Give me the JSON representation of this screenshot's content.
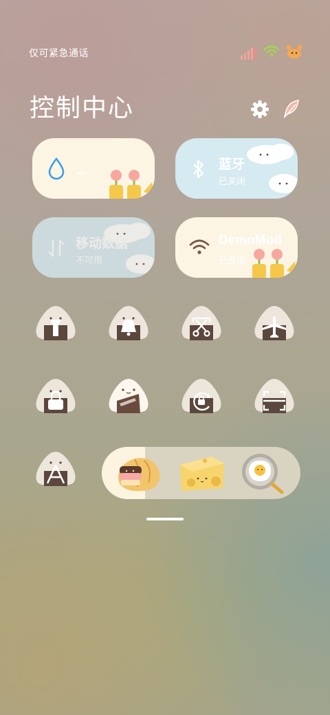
{
  "status_bar": {
    "carrier_text": "仅可紧急通话",
    "icons": [
      "signal-icon",
      "wifi-icon",
      "battery-crab-icon"
    ]
  },
  "header": {
    "title": "控制中心",
    "icons": [
      "settings-icon",
      "edit-feather-icon"
    ]
  },
  "tiles": [
    {
      "name": "water-tile",
      "icon": "water-drop-icon",
      "title": "--",
      "subtitle": "",
      "theme": "cream"
    },
    {
      "name": "bluetooth-tile",
      "icon": "bluetooth-icon",
      "title": "蓝牙",
      "subtitle": "已关闭",
      "theme": "blue"
    },
    {
      "name": "mobile-data-tile",
      "icon": "mobile-data-icon",
      "title": "移动数据",
      "subtitle": "不可用",
      "theme": "blue"
    },
    {
      "name": "wifi-tile",
      "icon": "wifi-icon",
      "title": "DemoMod",
      "subtitle": "已连接",
      "theme": "cream"
    }
  ],
  "toggles": [
    "flashlight-icon",
    "bell-icon",
    "screenshot-scissors-icon",
    "airplane-icon",
    "lock-icon",
    "reading-mode-icon",
    "rotation-lock-icon",
    "scan-icon",
    "font-a-icon"
  ],
  "brightness_switcher": {
    "items": [
      "croissant-icon",
      "cheese-icon",
      "egg-pan-icon"
    ]
  },
  "colors": {
    "tile_cream": "#fdf5e4",
    "tile_blue": "#d5eaf1",
    "onigiri_rice": "#f3ece2",
    "onigiri_nori": "#5b473d",
    "active_blue": "#3a9ee8"
  }
}
